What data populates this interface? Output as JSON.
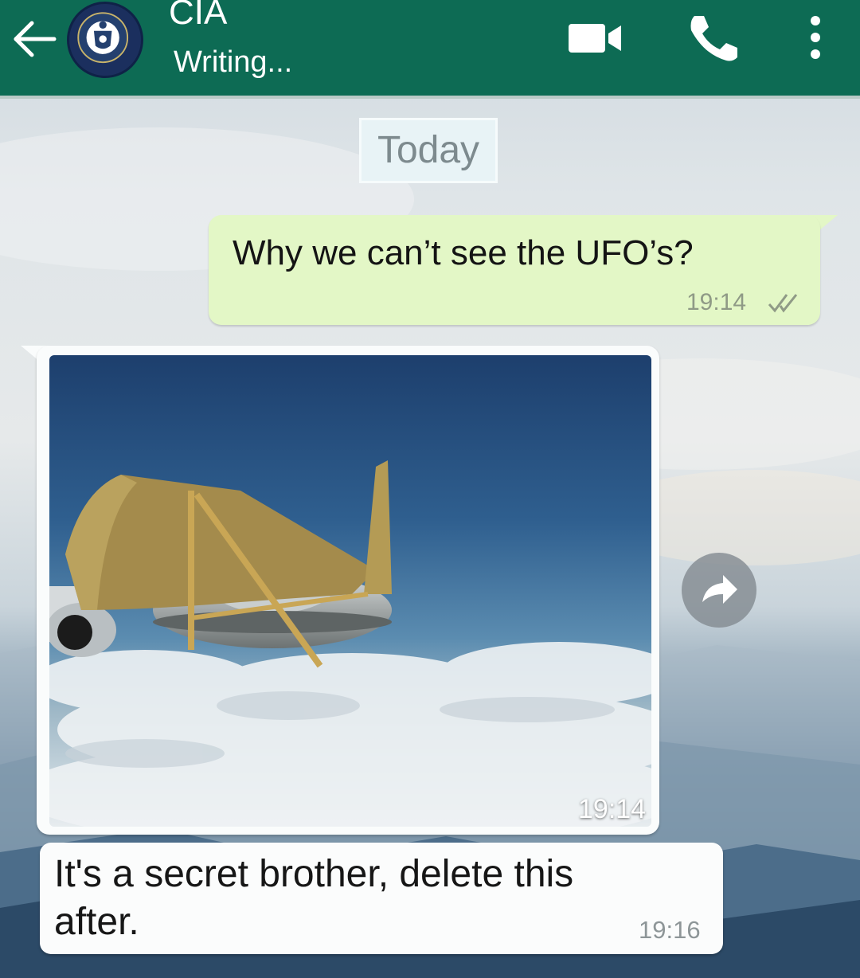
{
  "header": {
    "contact_name": "CIA",
    "status": "Writing...",
    "icons": {
      "back": "back-arrow-icon",
      "avatar": "cia-seal-avatar",
      "video": "video-call-icon",
      "call": "phone-call-icon",
      "menu": "more-options-icon"
    },
    "colors": {
      "bar": "#0d6b54",
      "text": "#ffffff"
    }
  },
  "chat": {
    "date_divider": "Today",
    "messages": [
      {
        "direction": "outgoing",
        "type": "text",
        "text": "Why we can’t see the UFO’s?",
        "time": "19:14",
        "status": "read-ticks"
      },
      {
        "direction": "incoming",
        "type": "image",
        "image_description": "flying saucer with cardboard airplane wings and tail over clouds",
        "time": "19:14"
      },
      {
        "direction": "incoming",
        "type": "text",
        "text": "It's a secret brother, delete this after.",
        "time": "19:16"
      }
    ],
    "forward_icon": "forward-arrow-icon",
    "colors": {
      "outgoing_bubble": "#e3f7c6",
      "incoming_bubble": "#fbfcfc"
    }
  }
}
